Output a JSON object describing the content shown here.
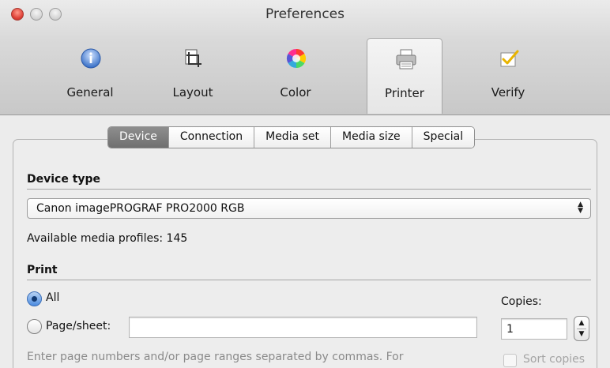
{
  "window": {
    "title": "Preferences"
  },
  "toolbar": {
    "items": [
      {
        "label": "General",
        "icon": "info-icon"
      },
      {
        "label": "Layout",
        "icon": "crop-icon"
      },
      {
        "label": "Color",
        "icon": "color-wheel-icon"
      },
      {
        "label": "Printer",
        "icon": "printer-icon",
        "selected": true
      },
      {
        "label": "Verify",
        "icon": "verify-check-icon"
      }
    ]
  },
  "tabs": {
    "items": [
      "Device",
      "Connection",
      "Media set",
      "Media size",
      "Special"
    ],
    "selected": "Device"
  },
  "device": {
    "section_title": "Device type",
    "device_type_value": "Canon imagePROGRAF PRO2000 RGB",
    "profiles_label": "Available media profiles: 145"
  },
  "print": {
    "section_title": "Print",
    "radio_all": "All",
    "radio_all_checked": true,
    "radio_page": "Page/sheet:",
    "radio_page_checked": false,
    "page_sheet_value": "",
    "copies_label": "Copies:",
    "copies_value": "1",
    "hint": "Enter page numbers and/or page ranges separated by commas. For",
    "sort_copies_label": "Sort copies",
    "sort_copies_checked": false
  },
  "colors": {
    "segment_active": "#7a7a7a",
    "radio_selected": "#4b8be0",
    "close_button": "#e0443a"
  }
}
